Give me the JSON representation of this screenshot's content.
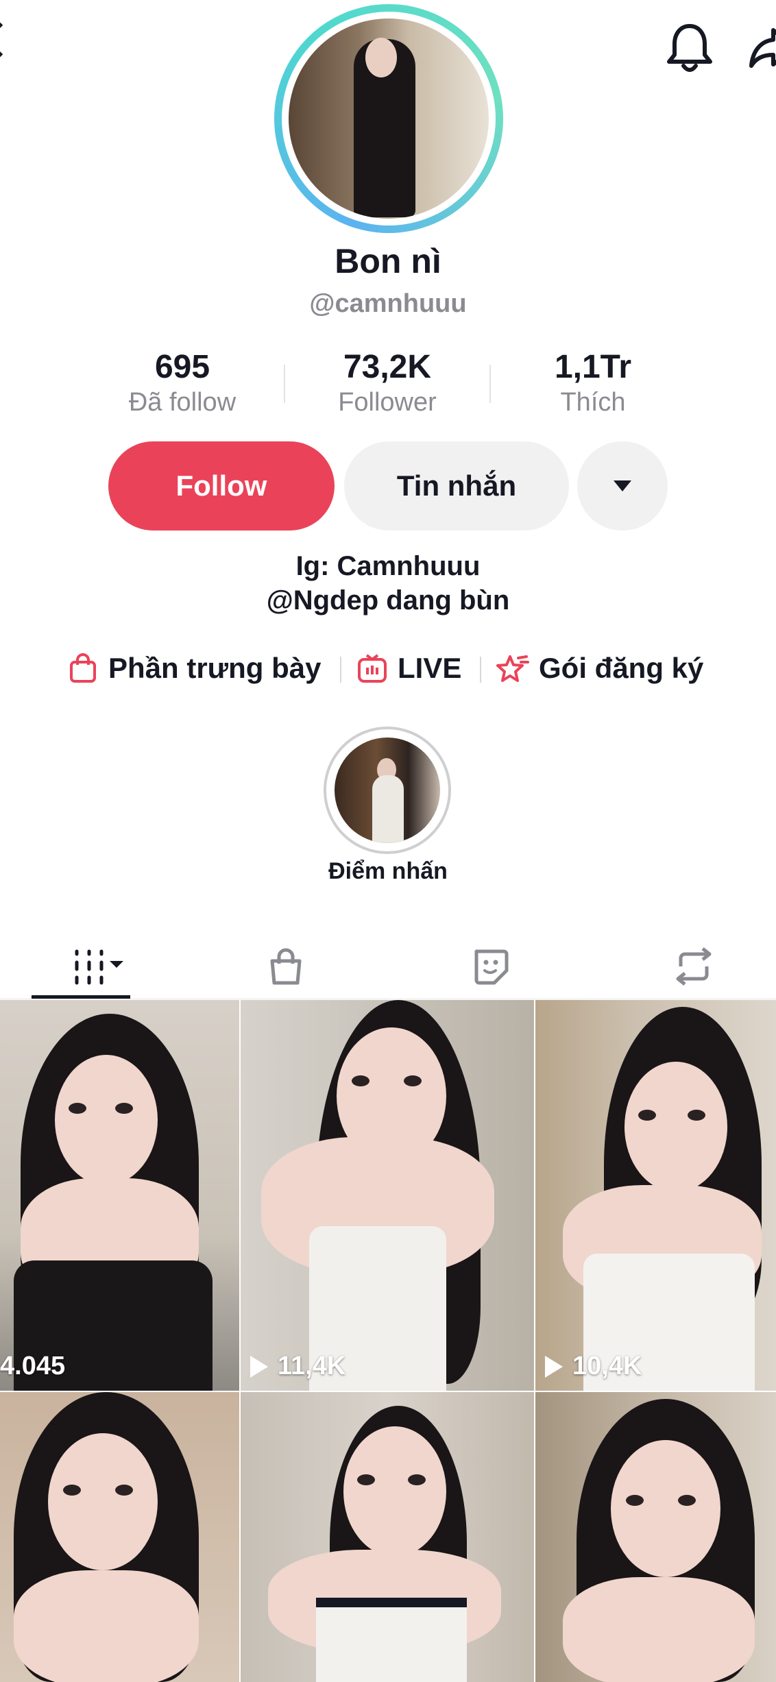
{
  "profile": {
    "display_name": "Bon nì",
    "username": "@camnhuuu"
  },
  "stats": [
    {
      "value": "695",
      "label": "Đã follow"
    },
    {
      "value": "73,2K",
      "label": "Follower"
    },
    {
      "value": "1,1Tr",
      "label": "Thích"
    }
  ],
  "actions": {
    "follow_label": "Follow",
    "message_label": "Tin nhắn"
  },
  "bio": {
    "line1": "Ig: Camnhuuu",
    "line2": "@Ngdep dang bùn"
  },
  "links": [
    {
      "label": "Phần trưng bày",
      "icon": "shopping-bag-icon"
    },
    {
      "label": "LIVE",
      "icon": "live-tv-icon"
    },
    {
      "label": "Gói đăng ký",
      "icon": "subscription-star-icon"
    }
  ],
  "highlight": {
    "label": "Điểm nhấn"
  },
  "tabs": [
    {
      "name": "videos",
      "icon": "grid-icon",
      "active": true
    },
    {
      "name": "shop",
      "icon": "shopping-bag-icon"
    },
    {
      "name": "liked",
      "icon": "sticker-icon"
    },
    {
      "name": "reposts",
      "icon": "repost-icon"
    }
  ],
  "videos": [
    {
      "views": "4.045"
    },
    {
      "views": "11,4K"
    },
    {
      "views": "10,4K"
    },
    {
      "views": ""
    },
    {
      "views": ""
    },
    {
      "views": ""
    }
  ],
  "colors": {
    "accent": "#ea4359",
    "secondary_button": "#f1f1f2",
    "muted_text": "#8a8b91"
  }
}
